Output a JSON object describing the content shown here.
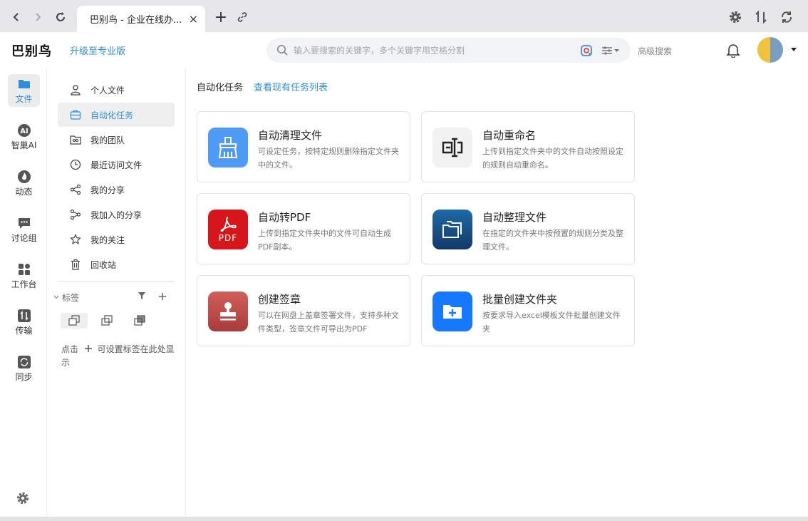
{
  "browser": {
    "tab_title": "巴别鸟 - 企业在线办...",
    "close_glyph": "×",
    "new_tab_glyph": "+"
  },
  "header": {
    "brand": "巴别鸟",
    "upgrade": "升级至专业版",
    "search_placeholder": "输入要搜索的关键字，多个关键字用空格分割",
    "advanced_search": "高级搜索"
  },
  "rail": {
    "items": [
      {
        "label": "文件",
        "icon": "folder-icon"
      },
      {
        "label": "智巢AI",
        "icon": "ai-icon"
      },
      {
        "label": "动态",
        "icon": "fire-icon"
      },
      {
        "label": "讨论组",
        "icon": "chat-icon"
      },
      {
        "label": "工作台",
        "icon": "apps-icon"
      },
      {
        "label": "传输",
        "icon": "transfer-icon"
      },
      {
        "label": "同步",
        "icon": "sync-icon"
      }
    ]
  },
  "subnav": {
    "items": [
      {
        "label": "个人文件",
        "icon": "person-icon"
      },
      {
        "label": "自动化任务",
        "icon": "briefcase-icon"
      },
      {
        "label": "我的团队",
        "icon": "team-icon"
      },
      {
        "label": "最近访问文件",
        "icon": "clock-icon"
      },
      {
        "label": "我的分享",
        "icon": "share-icon"
      },
      {
        "label": "我加入的分享",
        "icon": "joined-share-icon"
      },
      {
        "label": "我的关注",
        "icon": "star-icon"
      },
      {
        "label": "回收站",
        "icon": "trash-icon"
      }
    ],
    "tags_label": "标签",
    "tags_hint_prefix": "点击",
    "tags_hint_suffix": "可设置标签在此处显示"
  },
  "content": {
    "crumb": "自动化任务",
    "crumb_link": "查看现有任务列表",
    "cards": [
      {
        "title": "自动清理文件",
        "desc": "可设定任务，按特定规则删除指定文件夹中的文件。",
        "icon": "broom-icon",
        "color": "#4e9bf5"
      },
      {
        "title": "自动重命名",
        "desc": "上传到指定文件夹中的文件自动按照设定的规则自动重命名。",
        "icon": "rename-icon",
        "color": "#f2f2f2"
      },
      {
        "title": "自动转PDF",
        "desc": "上传到指定文件夹中的文件可自动生成PDF副本。",
        "icon": "pdf-icon",
        "color": "#d7161c",
        "tile_text": "PDF"
      },
      {
        "title": "自动整理文件",
        "desc": "在指定的文件夹中按预置的规则分类及整理文件。",
        "icon": "folders-icon",
        "color": "#1a4f86"
      },
      {
        "title": "创建签章",
        "desc": "可以在网盘上盖章签署文件，支持多种文件类型，签章文件可导出为PDF",
        "icon": "stamp-icon",
        "color": "#c0504d"
      },
      {
        "title": "批量创建文件夹",
        "desc": "按要求导入excel模板文件批量创建文件夹",
        "icon": "folder-add-icon",
        "color": "#1677ff"
      }
    ]
  },
  "colors": {
    "accent": "#2f8fdd",
    "chrome": "#e7e7e9"
  }
}
